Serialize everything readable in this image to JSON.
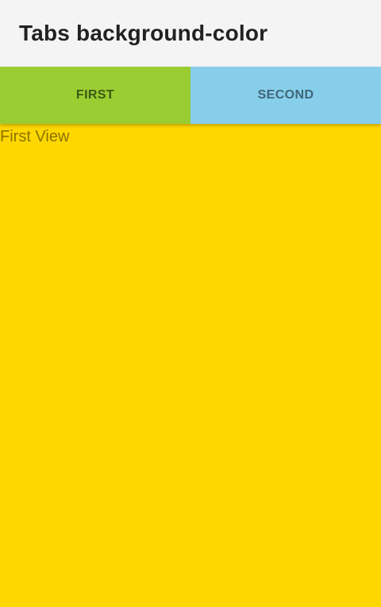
{
  "header": {
    "title": "Tabs background-color"
  },
  "tabs": [
    {
      "label": "FIRST",
      "background": "#9acd32",
      "selected": true
    },
    {
      "label": "SECOND",
      "background": "#87ceeb",
      "selected": false
    }
  ],
  "content": {
    "text": "First View",
    "background": "#ffd700"
  }
}
